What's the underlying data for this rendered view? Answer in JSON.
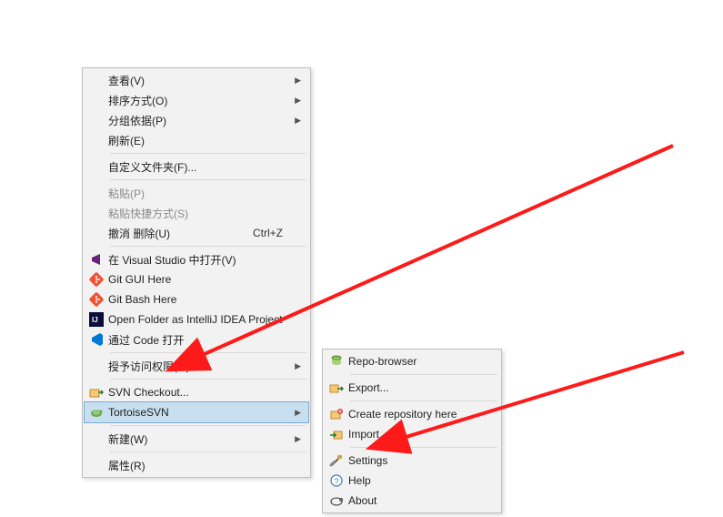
{
  "main_menu": {
    "view": {
      "label": "查看(V)"
    },
    "sort": {
      "label": "排序方式(O)"
    },
    "group": {
      "label": "分组依据(P)"
    },
    "refresh": {
      "label": "刷新(E)"
    },
    "customize": {
      "label": "自定义文件夹(F)..."
    },
    "paste": {
      "label": "粘贴(P)"
    },
    "paste_shortcut": {
      "label": "粘贴快捷方式(S)"
    },
    "undo_delete": {
      "label": "撤消 删除(U)",
      "shortcut": "Ctrl+Z"
    },
    "open_vs": {
      "label": "在 Visual Studio 中打开(V)"
    },
    "git_gui": {
      "label": "Git GUI Here"
    },
    "git_bash": {
      "label": "Git Bash Here"
    },
    "intellij": {
      "label": "Open Folder as IntelliJ IDEA Project"
    },
    "vscode": {
      "label": "通过 Code 打开"
    },
    "grant_access": {
      "label": "授予访问权限(G)"
    },
    "svn_checkout": {
      "label": "SVN Checkout..."
    },
    "tortoise": {
      "label": "TortoiseSVN"
    },
    "new": {
      "label": "新建(W)"
    },
    "properties": {
      "label": "属性(R)"
    }
  },
  "sub_menu": {
    "repo_browser": {
      "label": "Repo-browser"
    },
    "export": {
      "label": "Export..."
    },
    "create_repo": {
      "label": "Create repository here"
    },
    "import": {
      "label": "Import..."
    },
    "settings": {
      "label": "Settings"
    },
    "help": {
      "label": "Help"
    },
    "about": {
      "label": "About"
    }
  }
}
